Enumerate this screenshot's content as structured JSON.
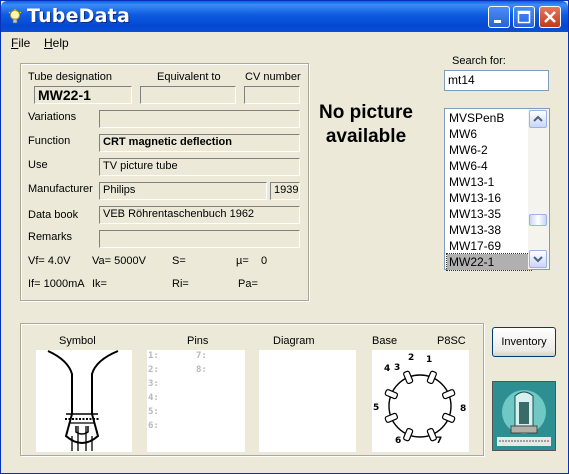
{
  "window": {
    "title": "TubeData"
  },
  "menu": [
    {
      "label": "File",
      "ul": "F",
      "rest": "ile"
    },
    {
      "label": "Help",
      "ul": "H",
      "rest": "elp"
    }
  ],
  "details": {
    "designation_label": "Tube designation",
    "equivalent_label": "Equivalent to",
    "cv_label": "CV number",
    "designation_value": "MW22-1",
    "equivalent_value": "",
    "cv_value": "",
    "variations_label": "Variations",
    "variations_value": "",
    "function_label": "Function",
    "function_value": "CRT magnetic deflection",
    "use_label": "Use",
    "use_value": "TV picture tube",
    "manufacturer_label": "Manufacturer",
    "manufacturer_value": "Philips",
    "year_value": "1939",
    "databook_label": "Data book",
    "databook_value": "VEB Röhrentaschenbuch 1962",
    "remarks_label": "Remarks",
    "remarks_value": ""
  },
  "parameters": {
    "vf": "Vf= 4.0V",
    "va": "Va= 5000V",
    "s": "S=",
    "mu": "µ=",
    "mu_value": "0",
    "if": "If= 1000mA",
    "ik": "Ik=",
    "ri": "Ri=",
    "pa": "Pa="
  },
  "search": {
    "label": "Search for:",
    "value": "mt14"
  },
  "tube_list": {
    "items": [
      "MVSPenB",
      "MW6",
      "MW6-2",
      "MW6-4",
      "MW13-1",
      "MW13-16",
      "MW13-35",
      "MW13-38",
      "MW17-69",
      "MW22-1"
    ],
    "selected": "MW22-1"
  },
  "picture": {
    "placeholder": "No picture available"
  },
  "bottom": {
    "symbol_label": "Symbol",
    "pins_label": "Pins",
    "diagram_label": "Diagram",
    "base_label": "Base",
    "base_type": "P8SC",
    "pins": [
      "1:",
      "2:",
      "3:",
      "4:",
      "5:",
      "6:",
      "7:",
      "8:"
    ],
    "base_pin_numbers": [
      "1",
      "2",
      "3",
      "4",
      "5",
      "6",
      "7",
      "8"
    ]
  },
  "buttons": {
    "inventory": "Inventory"
  },
  "colors": {
    "title_bar": "#0a5fe8",
    "window_bg": "#ece9d8",
    "list_selection": "#b0b0b0"
  }
}
